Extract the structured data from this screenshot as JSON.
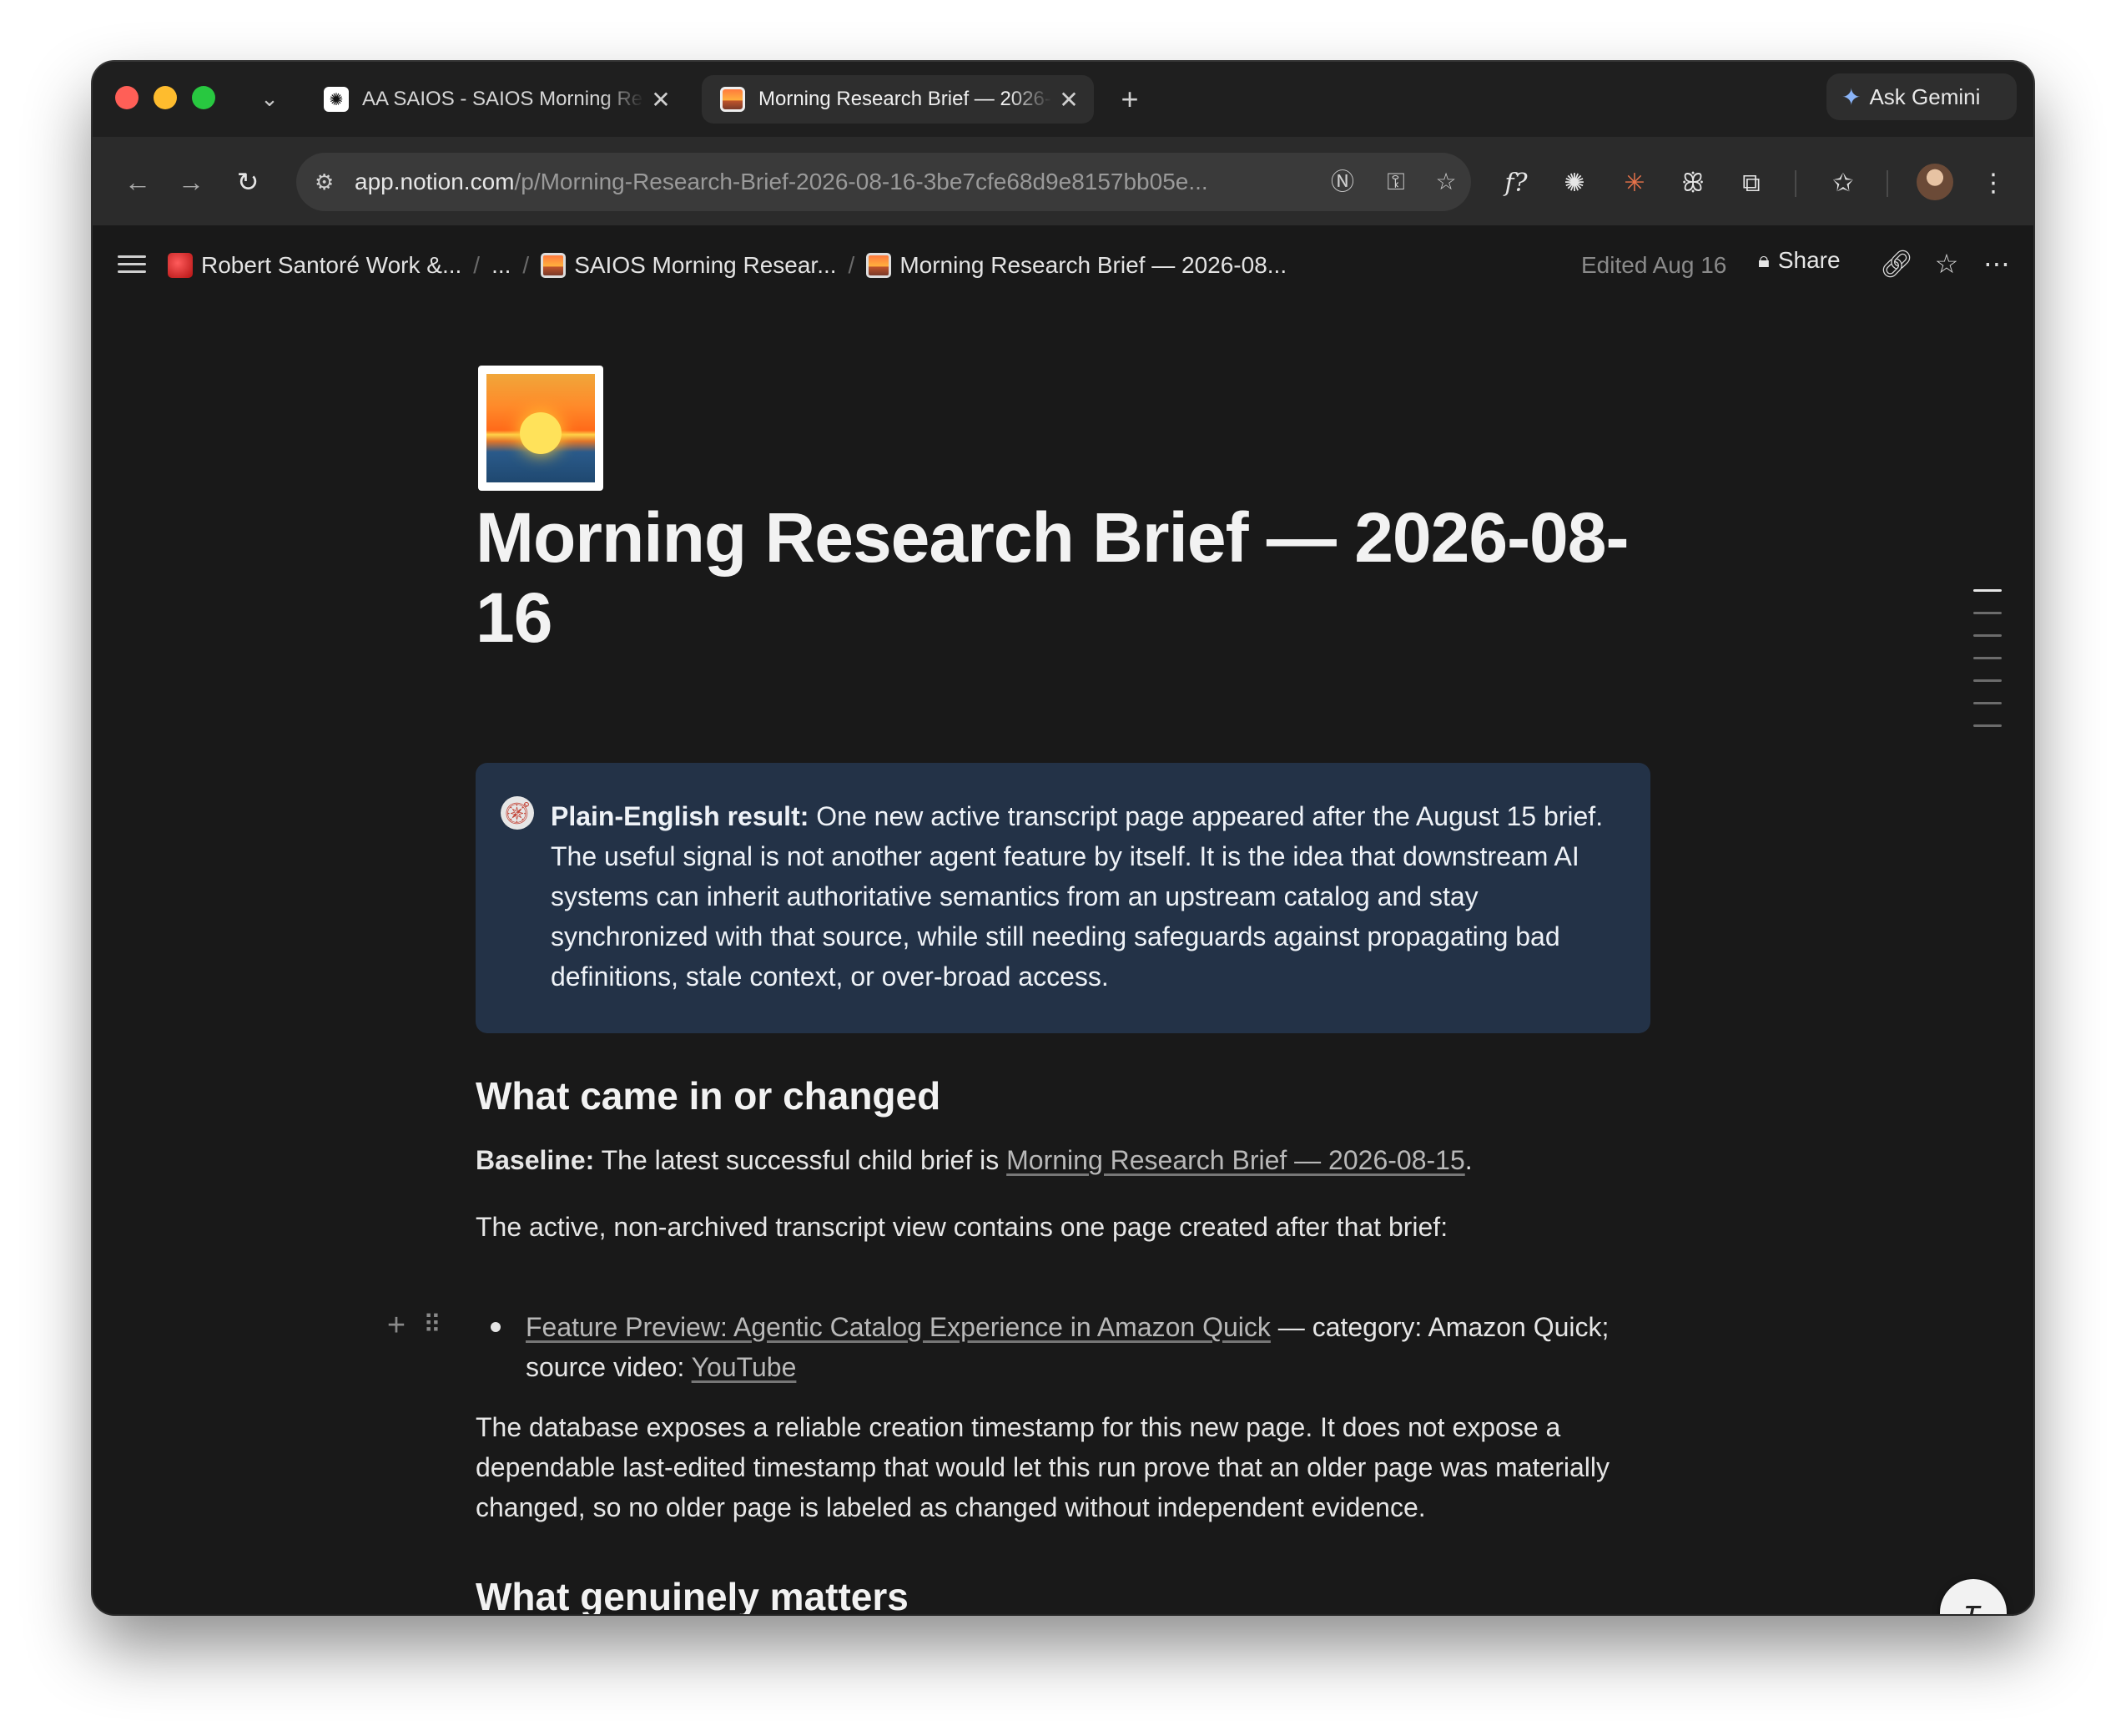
{
  "browser": {
    "tabs": [
      {
        "title": "AA SAIOS - SAIOS Morning Research",
        "icon": "openai-icon",
        "active": false
      },
      {
        "title": "Morning Research Brief — 2026-08-16",
        "icon": "sunrise-icon",
        "active": true
      }
    ],
    "new_tab_label": "+",
    "ask_gemini_label": "Ask Gemini",
    "url_host": "app.notion.com",
    "url_path": "/p/Morning-Research-Brief-2026-08-16-3be7cfe68d9e8157bb05e..."
  },
  "notion": {
    "breadcrumbs": [
      {
        "label": "Robert Santoré Work &...",
        "icon": "workspace-icon"
      },
      {
        "label": "..."
      },
      {
        "label": "SAIOS Morning Resear...",
        "icon": "sunrise-icon"
      },
      {
        "label": "Morning Research Brief — 2026-08...",
        "icon": "sunrise-icon"
      }
    ],
    "edited_label": "Edited Aug 16",
    "share_label": "Share"
  },
  "page": {
    "title": "Morning Research Brief — 2026-08-16",
    "callout": {
      "icon": "compass-icon",
      "bold": "Plain-English result:",
      "text": " One new active transcript page appeared after the August 15 brief. The useful signal is not another agent feature by itself. It is the idea that downstream AI systems can inherit authoritative semantics from an upstream catalog and stay synchronized with that source, while still needing safeguards against propagating bad definitions, stale context, or over-broad access."
    },
    "section1_heading": "What came in or changed",
    "baseline": {
      "bold": "Baseline:",
      "text": " The latest successful child brief is ",
      "link": "Morning Research Brief — 2026-08-15",
      "end": "."
    },
    "active_view_text": "The active, non-archived transcript view contains one page created after that brief:",
    "bullet": {
      "link": "Feature Preview: Agentic Catalog Experience in Amazon Quick",
      "text": " — category: Amazon Quick; source video: ",
      "source_link": "YouTube"
    },
    "timestamp_text": "The database exposes a reliable creation timestamp for this new page. It does not expose a dependable last-edited timestamp that would let this run prove that an older page was materially changed, so no older page is labeled as changed without independent evidence.",
    "section2_heading": "What genuinely matters"
  }
}
